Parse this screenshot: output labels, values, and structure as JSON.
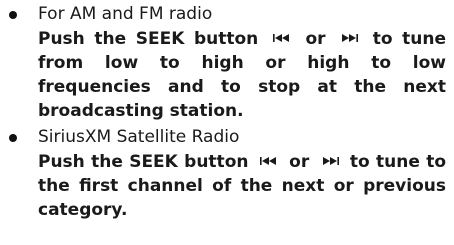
{
  "items": [
    {
      "title": "For AM and FM radio",
      "body_before": "Push the SEEK button",
      "icon_prev": "seek-back-icon",
      "connector": "or",
      "icon_next": "seek-forward-icon",
      "body_after": "to tune from low to high or high to low frequencies and to stop at the next broadcasting station."
    },
    {
      "title": "SiriusXM Satellite Radio",
      "body_before": "Push the SEEK button",
      "icon_prev": "seek-back-icon",
      "connector": "or",
      "icon_next": "seek-forward-icon",
      "body_after": "to tune to the first channel of the next or previous category."
    }
  ]
}
